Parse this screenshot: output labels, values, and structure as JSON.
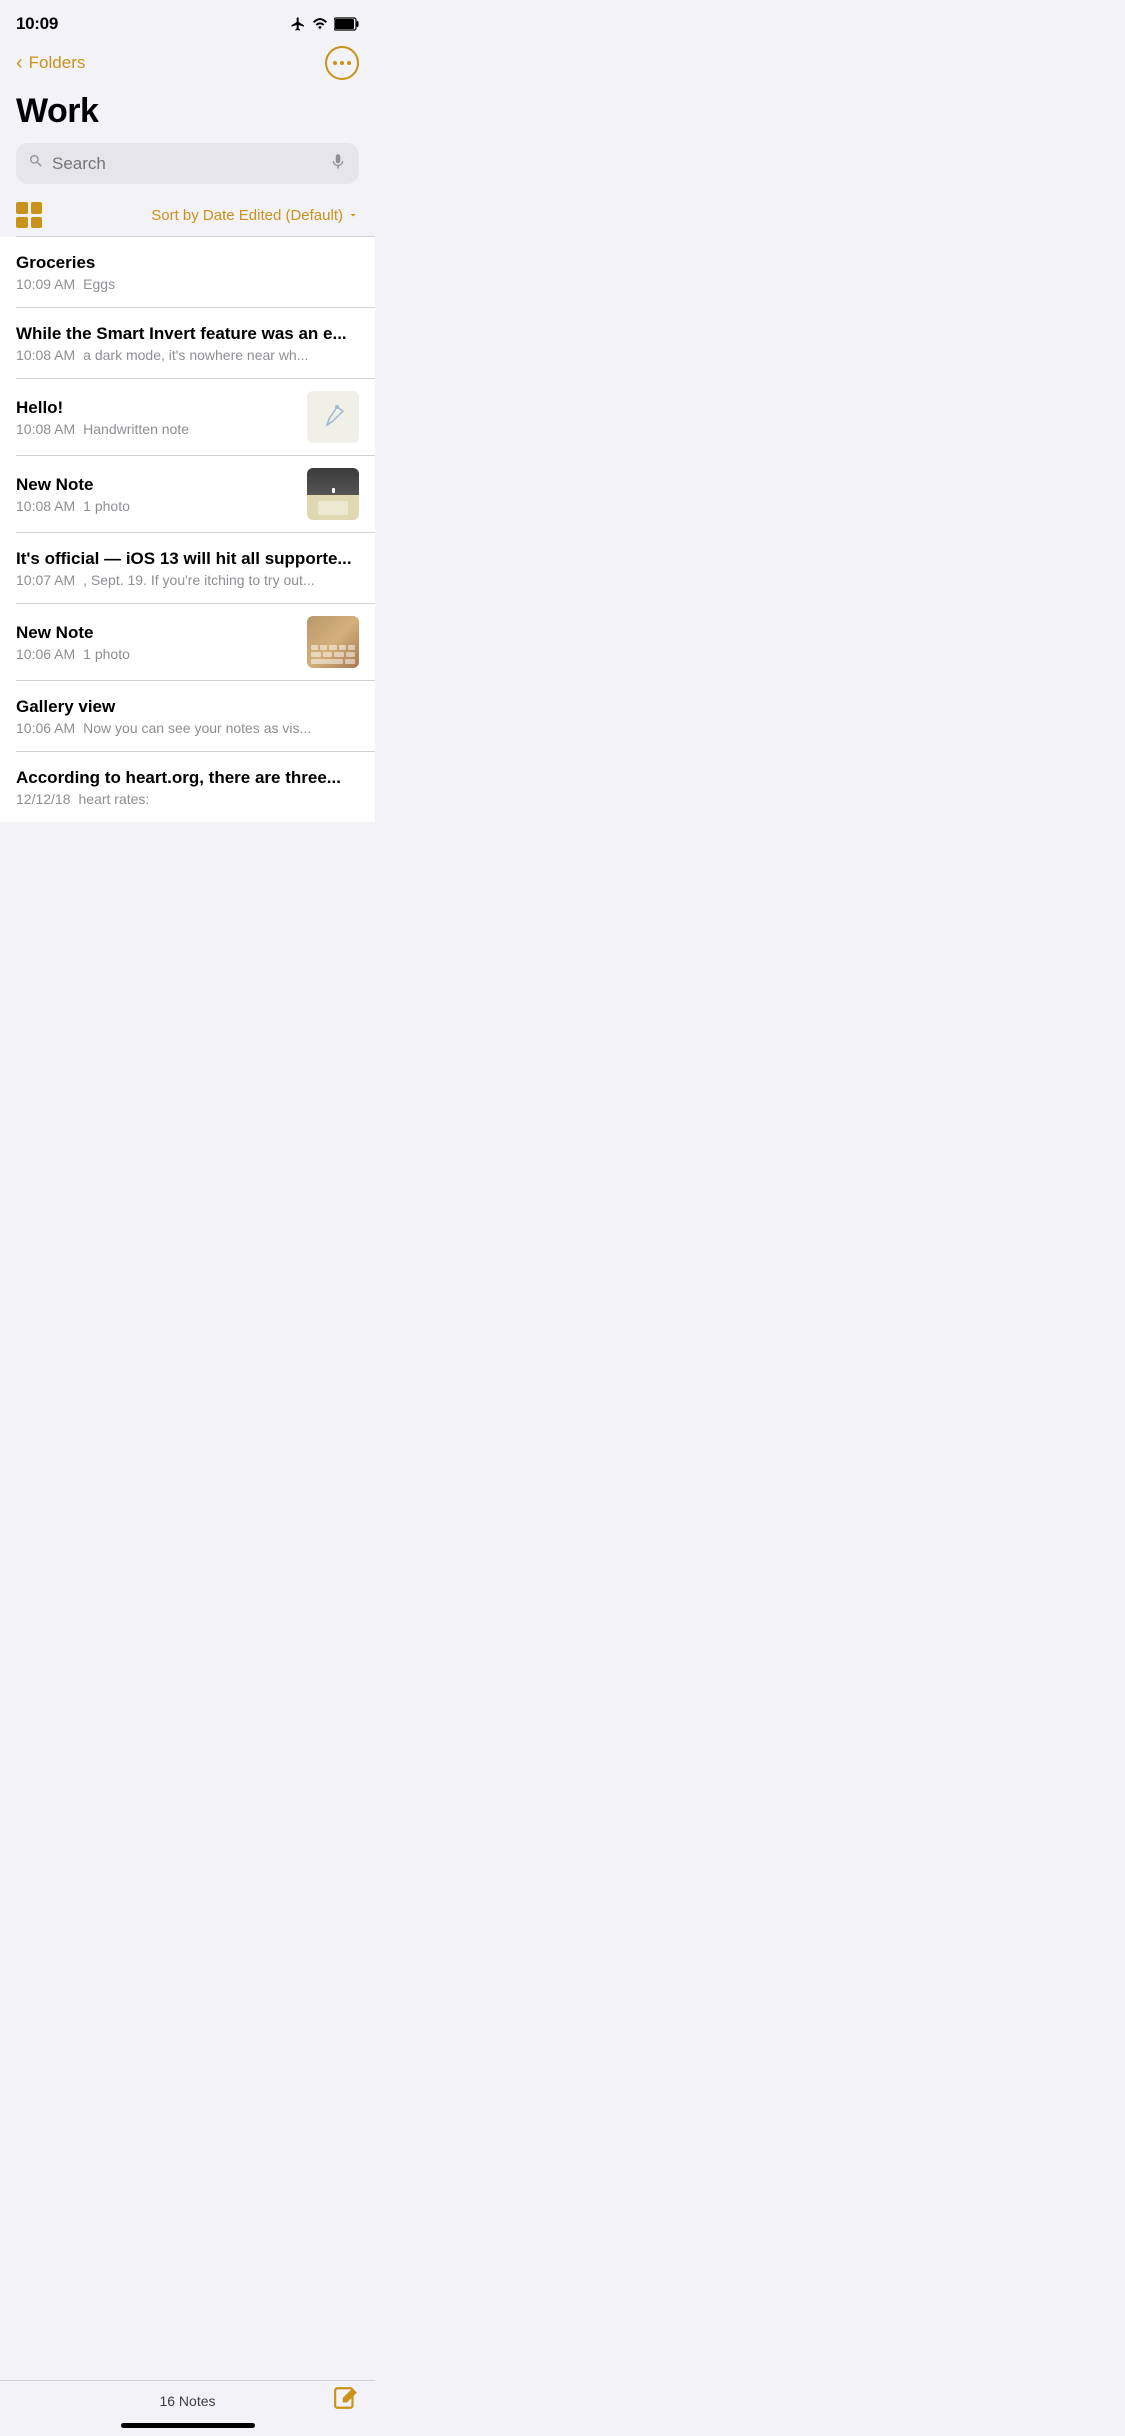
{
  "statusBar": {
    "time": "10:09"
  },
  "navBar": {
    "backLabel": "Folders",
    "moreAriaLabel": "More options"
  },
  "pageTitle": "Work",
  "searchBar": {
    "placeholder": "Search"
  },
  "toolbar": {
    "sortLabel": "Sort by Date Edited (Default)"
  },
  "notes": [
    {
      "id": "groceries",
      "title": "Groceries",
      "time": "10:09 AM",
      "preview": "Eggs",
      "hasThumbnail": false
    },
    {
      "id": "smart-invert",
      "title": "While the Smart Invert feature was an e...",
      "time": "10:08 AM",
      "preview": "a dark mode, it's nowhere near wh...",
      "hasThumbnail": false
    },
    {
      "id": "hello",
      "title": "Hello!",
      "time": "10:08 AM",
      "preview": "Handwritten note",
      "hasThumbnail": true,
      "thumbnailType": "handwritten"
    },
    {
      "id": "new-note-1",
      "title": "New Note",
      "time": "10:08 AM",
      "preview": "1 photo",
      "hasThumbnail": true,
      "thumbnailType": "road"
    },
    {
      "id": "ios13",
      "title": "It's official — iOS 13 will hit all supporte...",
      "time": "10:07 AM",
      "preview": ", Sept. 19. If you're itching to try out...",
      "hasThumbnail": false
    },
    {
      "id": "new-note-2",
      "title": "New Note",
      "time": "10:06 AM",
      "preview": "1 photo",
      "hasThumbnail": true,
      "thumbnailType": "keyboard"
    },
    {
      "id": "gallery-view",
      "title": "Gallery view",
      "time": "10:06 AM",
      "preview": "Now you can see your notes as vis...",
      "hasThumbnail": false
    },
    {
      "id": "heart-org",
      "title": "According to heart.org, there are three...",
      "time": "12/12/18",
      "preview": "heart rates:",
      "hasThumbnail": false
    }
  ],
  "bottomBar": {
    "notesCount": "16 Notes"
  },
  "colors": {
    "accent": "#c9921a"
  }
}
